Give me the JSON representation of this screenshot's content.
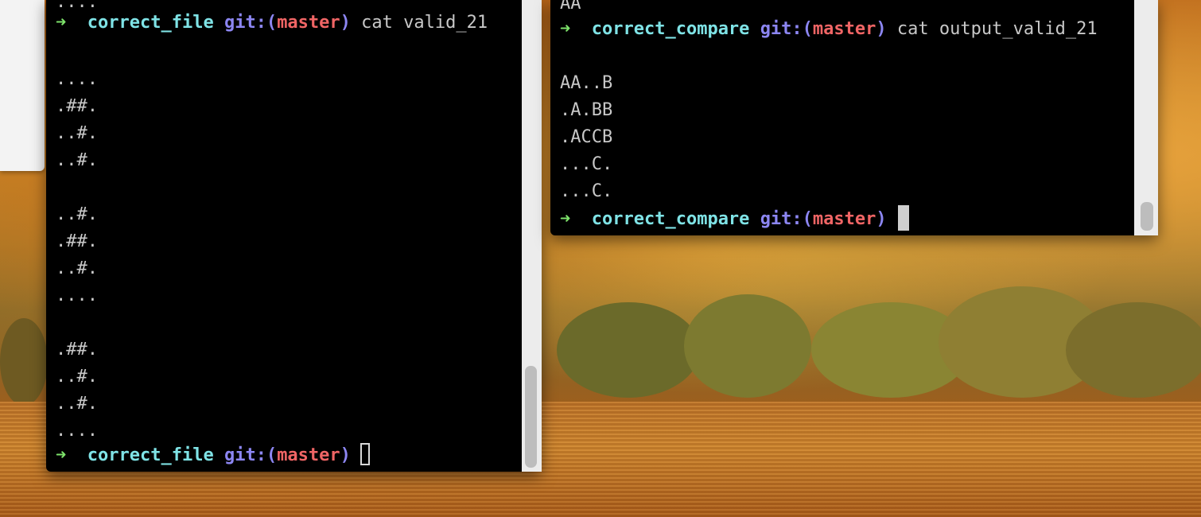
{
  "left_terminal": {
    "lines": [
      "....",
      "",
      "",
      "....",
      ".##.",
      "..#.",
      "..#.",
      "",
      "..#.",
      ".##.",
      "..#.",
      "....",
      "",
      ".##.",
      "..#.",
      "..#.",
      "...."
    ],
    "prompt_top": {
      "arrow": "➜",
      "directory": "correct_file",
      "git_label": "git:(",
      "branch": "master",
      "git_close": ")",
      "command": "cat valid_21"
    },
    "prompt_bottom": {
      "arrow": "➜",
      "directory": "correct_file",
      "git_label": "git:(",
      "branch": "master",
      "git_close": ")"
    }
  },
  "right_terminal": {
    "top_line": "AA",
    "prompt_top": {
      "arrow": "➜",
      "directory": "correct_compare",
      "git_label": "git:(",
      "branch": "master",
      "git_close": ")",
      "command": "cat output_valid_21"
    },
    "output": [
      "AA..B",
      ".A.BB",
      ".ACCB",
      "...C.",
      "...C."
    ],
    "prompt_bottom": {
      "arrow": "➜",
      "directory": "correct_compare",
      "git_label": "git:(",
      "branch": "master",
      "git_close": ")"
    }
  },
  "colors": {
    "arrow": "#7ee36b",
    "directory": "#7fe3e6",
    "git": "#8c86f2",
    "branch": "#f06565",
    "text": "#c8c8c8",
    "terminal_bg": "#000000"
  }
}
